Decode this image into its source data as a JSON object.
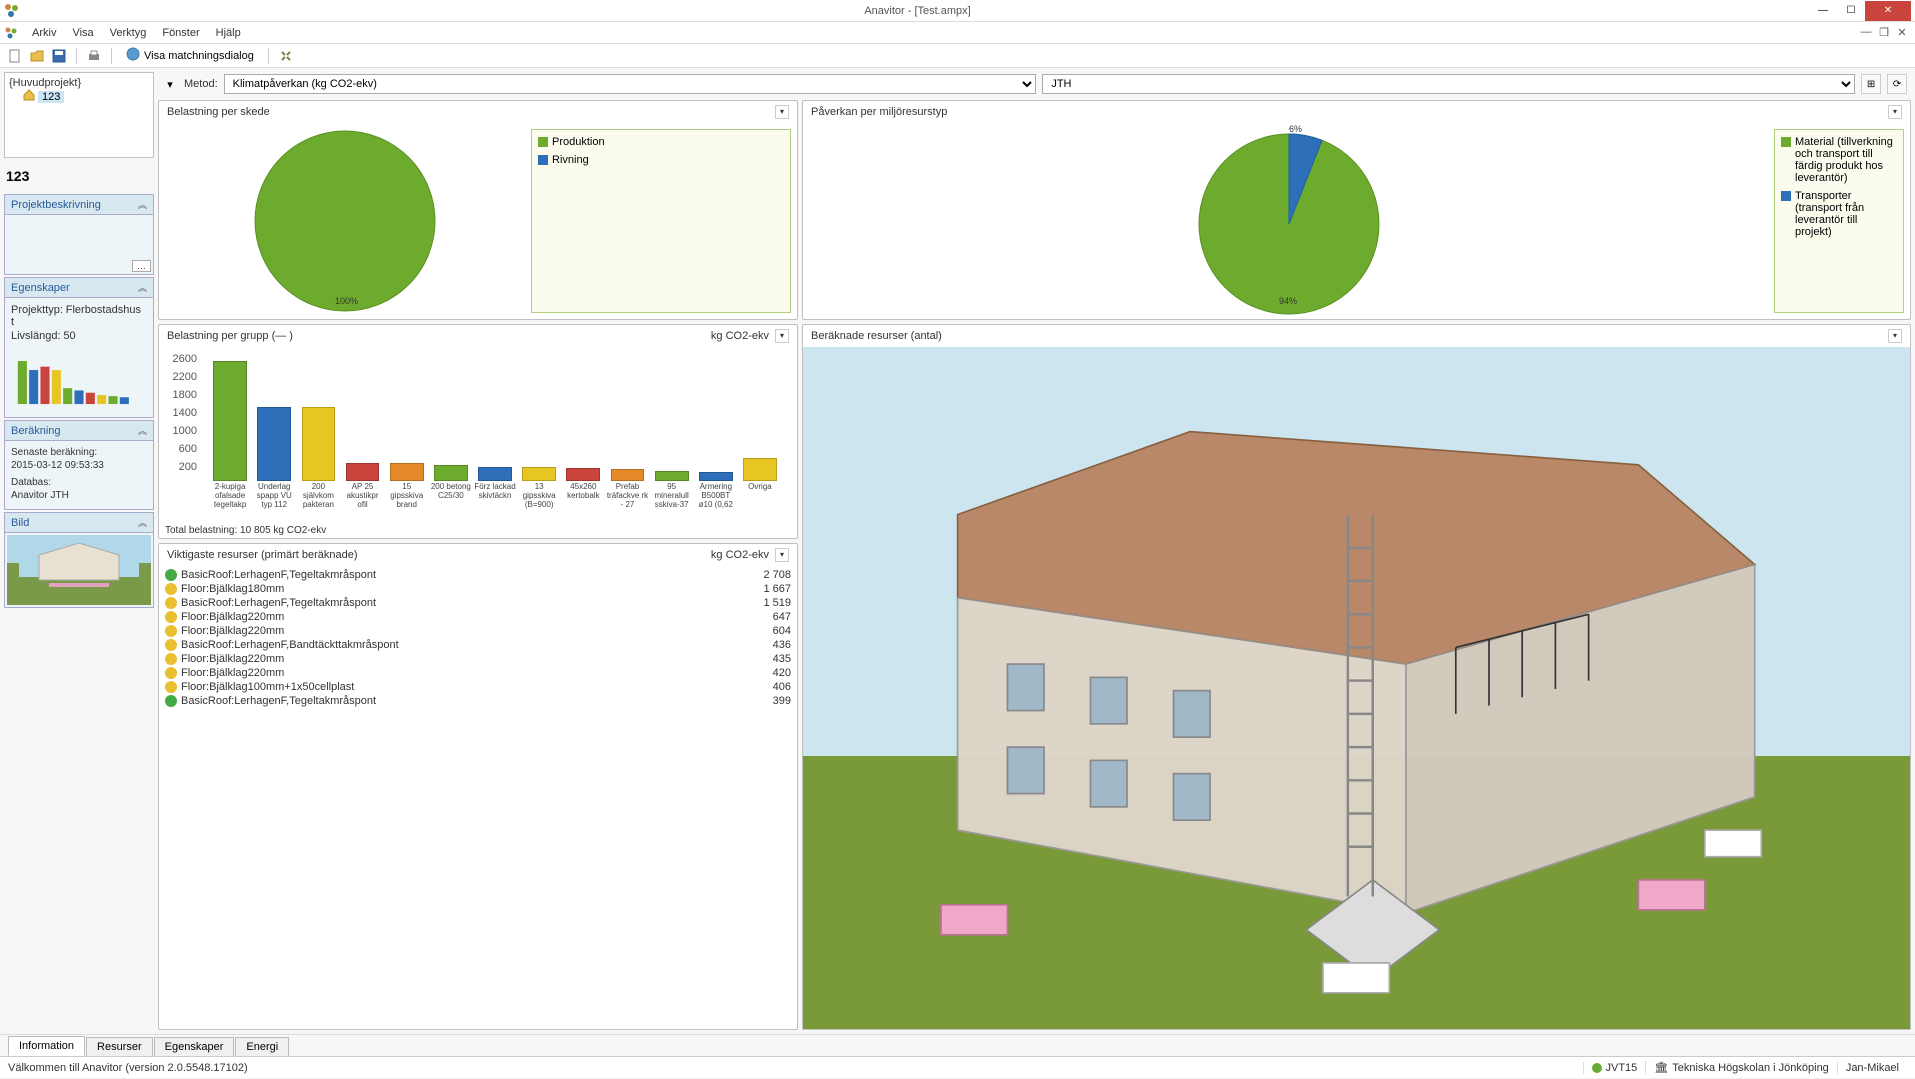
{
  "title": "Anavitor - [Test.ampx]",
  "menu": {
    "arkiv": "Arkiv",
    "visa": "Visa",
    "verktyg": "Verktyg",
    "fonster": "Fönster",
    "hjalp": "Hjälp"
  },
  "toolbar": {
    "match": "Visa matchningsdialog"
  },
  "tree": {
    "root": "{Huvudprojekt}",
    "child": "123"
  },
  "project_title": "123",
  "sections": {
    "desc": "Projektbeskrivning",
    "props": "Egenskaper",
    "calc": "Beräkning",
    "img": "Bild"
  },
  "props": {
    "type_label": "Projekttyp:",
    "type_val": "Flerbostadshus t",
    "life_label": "Livslängd:",
    "life_val": "50"
  },
  "calc": {
    "latest_label": "Senaste beräkning:",
    "latest_val": "2015-03-12 09:53:33",
    "db_label": "Databas:",
    "db_val": "Anavitor JTH"
  },
  "method": {
    "label": "Metod:",
    "options": [
      "Klimatpåverkan (kg CO2-ekv)"
    ],
    "side_options": [
      "JTH"
    ]
  },
  "panels": {
    "p1_title": "Belastning per skede",
    "p2_title": "Påverkan per miljöresurstyp",
    "p3_title": "Belastning per grupp (— )",
    "p3_unit": "kg CO2-ekv",
    "p4_title": "Beräknade resurser (antal)",
    "p5_title": "Viktigaste resurser (primärt beräknade)",
    "p5_unit": "kg CO2-ekv"
  },
  "legend1": {
    "a": "Produktion",
    "b": "Rivning"
  },
  "legend2": {
    "a": "Material (tillverkning och transport till färdig produkt hos leverantör)",
    "b": "Transporter (transport från leverantör till projekt)"
  },
  "total_line": "Total belastning: 10 805 kg CO2-ekv",
  "chart_data": [
    {
      "type": "pie",
      "title": "Belastning per skede",
      "series": [
        {
          "name": "Produktion",
          "value": 100,
          "color": "#6dab2e"
        },
        {
          "name": "Rivning",
          "value": 0,
          "color": "#2d6fb8"
        }
      ],
      "labels": [
        "100%"
      ]
    },
    {
      "type": "pie",
      "title": "Påverkan per miljöresurstyp",
      "series": [
        {
          "name": "Material",
          "value": 94,
          "color": "#6dab2e"
        },
        {
          "name": "Transporter",
          "value": 6,
          "color": "#2d6fb8"
        }
      ],
      "labels": [
        "94%",
        "6%"
      ]
    },
    {
      "type": "bar",
      "title": "Belastning per grupp",
      "ylabel": "kg CO2-ekv",
      "ylim": [
        0,
        2600
      ],
      "categories": [
        "2-kupiga ofalsade tegeltakp",
        "Underlag spapp VU typ 112",
        "200 självkom pakteran",
        "AP 25 akustikpr ofil",
        "15 gipsskiva brand",
        "200 betong C25/30",
        "Förz lackad skivtäckn",
        "13 gipsskiva (B=900)",
        "45x260 kertobalk",
        "Prefab träfackve rk - 27",
        "95 mineralull sskiva-37",
        "Armering B500BT ø10 (0,62",
        "Övriga"
      ],
      "values": [
        2600,
        1600,
        1600,
        400,
        400,
        350,
        300,
        300,
        280,
        250,
        220,
        200,
        500
      ],
      "colors": [
        "#6dab2e",
        "#2d6fb8",
        "#e7c523",
        "#c8443c",
        "#e58a2a",
        "#6dab2e",
        "#2d6fb8",
        "#e7c523",
        "#c8443c",
        "#e58a2a",
        "#6dab2e",
        "#2d6fb8",
        "#e7c523"
      ]
    }
  ],
  "resources": [
    {
      "status": "ok",
      "name": "BasicRoof:LerhagenF,Tegeltakmråspont",
      "value": "2 708"
    },
    {
      "status": "warn",
      "name": "Floor:Bjälklag180mm",
      "value": "1 667"
    },
    {
      "status": "warn",
      "name": "BasicRoof:LerhagenF,Tegeltakmråspont",
      "value": "1 519"
    },
    {
      "status": "warn",
      "name": "Floor:Bjälklag220mm",
      "value": "647"
    },
    {
      "status": "warn",
      "name": "Floor:Bjälklag220mm",
      "value": "604"
    },
    {
      "status": "warn",
      "name": "BasicRoof:LerhagenF,Bandtäckttakmråspont",
      "value": "436"
    },
    {
      "status": "warn",
      "name": "Floor:Bjälklag220mm",
      "value": "435"
    },
    {
      "status": "warn",
      "name": "Floor:Bjälklag220mm",
      "value": "420"
    },
    {
      "status": "warn",
      "name": "Floor:Bjälklag100mm+1x50cellplast",
      "value": "406"
    },
    {
      "status": "ok",
      "name": "BasicRoof:LerhagenF,Tegeltakmråspont",
      "value": "399"
    }
  ],
  "tabs": {
    "info": "Information",
    "res": "Resurser",
    "eg": "Egenskaper",
    "en": "Energi"
  },
  "status": {
    "welcome": "Välkommen till Anavitor (version 2.0.5548.17102)",
    "proj": "JVT15",
    "org": "Tekniska Högskolan i Jönköping",
    "user": "Jan-Mikael"
  }
}
